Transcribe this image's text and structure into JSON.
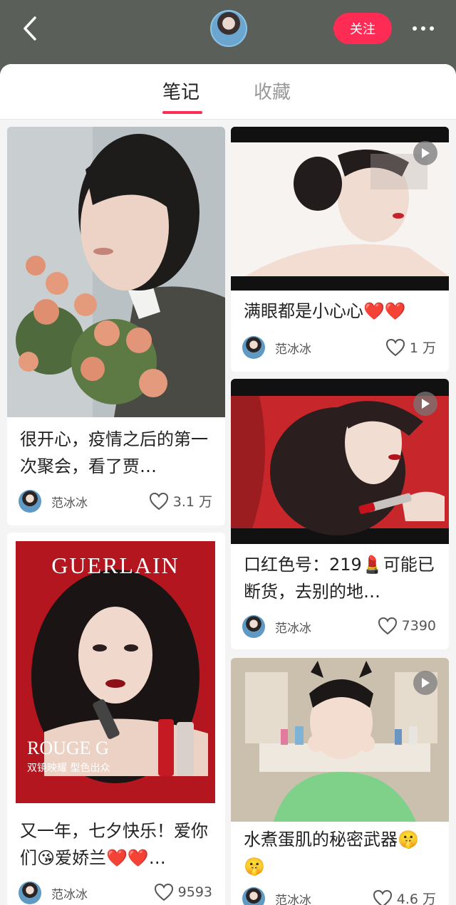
{
  "header": {
    "follow_label": "关注"
  },
  "tabs": [
    {
      "label": "笔记"
    },
    {
      "label": "收藏"
    }
  ],
  "notes": [
    {
      "title": "很开心，疫情之后的第一次聚会，看了贾…",
      "author": "范冰冰",
      "likes": "3.1 万",
      "video": false
    },
    {
      "title": "满眼都是小心心❤️❤️",
      "author": "范冰冰",
      "likes": "1 万",
      "video": true
    },
    {
      "title": "口红色号：219💄可能已断货，去别的地…",
      "author": "范冰冰",
      "likes": "7390",
      "video": true
    },
    {
      "title": "又一年，七夕快乐！爱你们😘爱娇兰❤️❤️…",
      "author": "范冰冰",
      "likes": "9593",
      "video": false,
      "image_text": {
        "brand": "GUERLAIN",
        "product": "ROUGE G",
        "tagline": "双镜映耀 型色出众"
      }
    },
    {
      "title": "水煮蛋肌的秘密武器🤫🤫",
      "author": "范冰冰",
      "likes": "4.6 万",
      "video": true
    }
  ],
  "colors": {
    "accent": "#fe2c55",
    "topbar": "#5a5f59"
  }
}
